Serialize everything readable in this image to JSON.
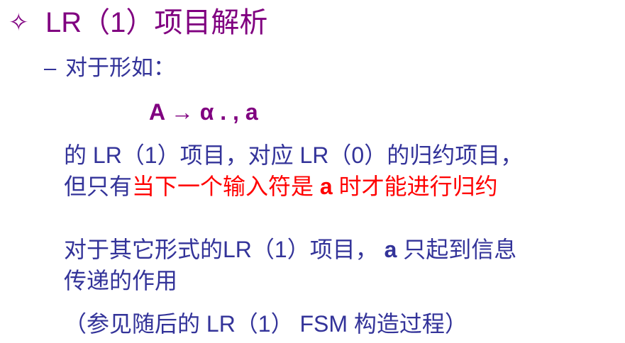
{
  "title": {
    "bullet": "✧",
    "text": "LR（1）项目解析"
  },
  "subheading": {
    "dash": "–",
    "text": "对于形如："
  },
  "formula": "A → α . ,  a",
  "paragraph1": {
    "line1": "的 LR（1）项目，对应 LR（0）的归约项目，",
    "line2_prefix": "但只有",
    "line2_red": "当下一个输入符是 ",
    "line2_red_bold": "a",
    "line2_red_suffix": " 时才能进行归约"
  },
  "paragraph2": {
    "line1_prefix": "对于其它形式的LR（1）项目， ",
    "line1_bold": "a",
    "line1_suffix": " 只起到信息",
    "line2": "传递的作用"
  },
  "footnote": "（参见随后的 LR（1） FSM 构造过程）",
  "colors": {
    "title": "#800080",
    "body": "#333399",
    "highlight": "#ff0000",
    "background": "#ffffff"
  }
}
